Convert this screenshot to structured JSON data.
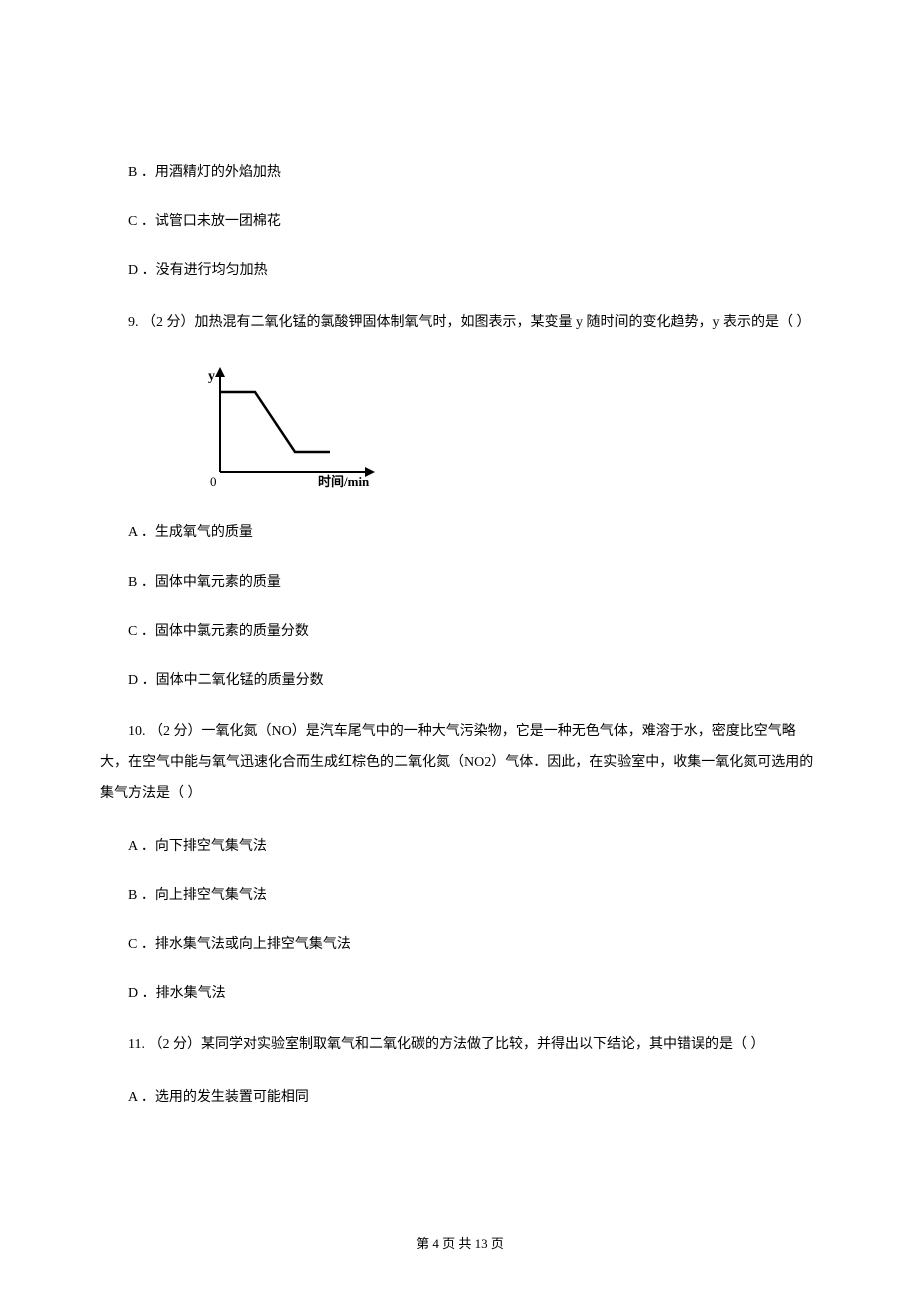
{
  "q8": {
    "optB": "B ．用酒精灯的外焰加热",
    "optC": "C ．试管口未放一团棉花",
    "optD": "D ．没有进行均匀加热"
  },
  "q9": {
    "stem": "9.  （2 分）加热混有二氧化锰的氯酸钾固体制氧气时，如图表示，某变量 y 随时间的变化趋势，y 表示的是（    ）",
    "yLabel": "y",
    "xLabel": "时间/min",
    "origin": "0",
    "optA": "A ．生成氧气的质量",
    "optB": "B ．固体中氧元素的质量",
    "optC": "C ．固体中氯元素的质量分数",
    "optD": "D ．固体中二氧化锰的质量分数"
  },
  "q10": {
    "stem": "10.  （2 分）一氧化氮（NO）是汽车尾气中的一种大气污染物，它是一种无色气体，难溶于水，密度比空气略大，在空气中能与氧气迅速化合而生成红棕色的二氧化氮（NO2）气体．因此，在实验室中，收集一氧化氮可选用的集气方法是（    ）",
    "optA": "A ．向下排空气集气法",
    "optB": "B ．向上排空气集气法",
    "optC": "C ．排水集气法或向上排空气集气法",
    "optD": "D ．排水集气法"
  },
  "q11": {
    "stem": "11.  （2 分）某同学对实验室制取氧气和二氧化碳的方法做了比较，并得出以下结论，其中错误的是（    ）",
    "optA": "A ．选用的发生装置可能相同"
  },
  "chart_data": {
    "type": "line",
    "title": "",
    "xlabel": "时间/min",
    "ylabel": "y",
    "x": [
      0,
      1,
      2,
      3,
      4
    ],
    "y": [
      4,
      4,
      1,
      1,
      1
    ],
    "xlim": [
      0,
      4.5
    ],
    "ylim": [
      0,
      5
    ]
  },
  "footer": "第 4 页 共 13 页"
}
